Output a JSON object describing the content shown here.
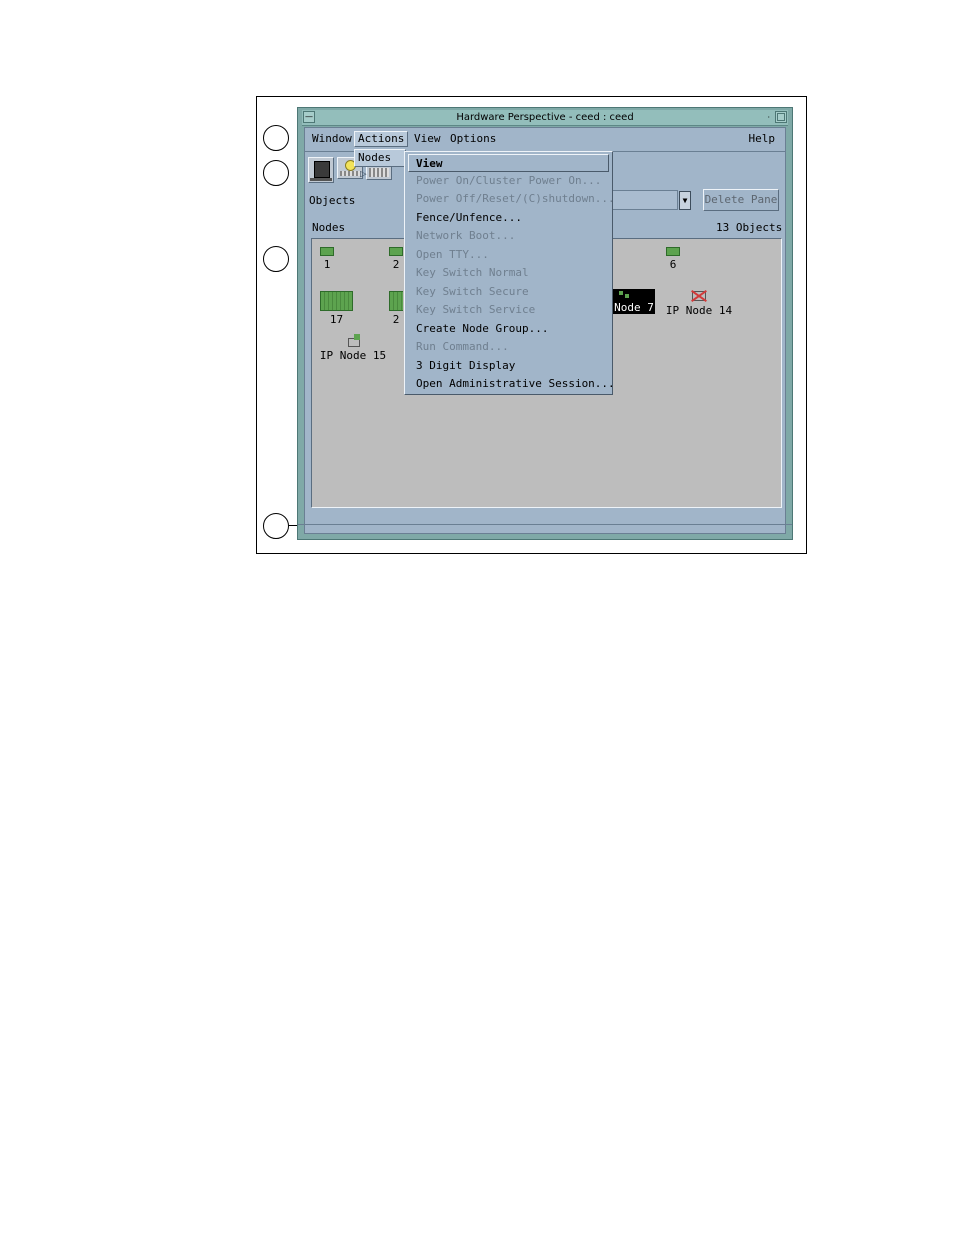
{
  "window": {
    "title": "Hardware Perspective - ceed : ceed"
  },
  "menubar": {
    "items": [
      "Window",
      "Actions",
      "View",
      "Options"
    ],
    "help": "Help"
  },
  "toolbar": {
    "buttons": [
      {
        "icon": "notebook-icon"
      },
      {
        "icon": "lightbulb-icon"
      },
      {
        "icon": "power-off-icon"
      }
    ]
  },
  "objects_label": "Objects",
  "delete_pane_label": "Delete Pane",
  "pane": {
    "title": "Nodes",
    "count": "13 Objects",
    "nodes": [
      "1",
      "2",
      "6",
      "17",
      "2",
      "Node 7",
      "IP Node 14",
      "IP Node 15"
    ]
  },
  "submenu": {
    "label": "Nodes",
    "arrow": "▷"
  },
  "dropdown": {
    "items": [
      {
        "label": "View",
        "enabled": true
      },
      {
        "label": "Power On/Cluster Power On...",
        "enabled": false
      },
      {
        "label": "Power Off/Reset/(C)shutdown...",
        "enabled": false
      },
      {
        "label": "Fence/Unfence...",
        "enabled": true
      },
      {
        "label": "Network Boot...",
        "enabled": false
      },
      {
        "label": "Open TTY...",
        "enabled": false
      },
      {
        "label": "Key Switch Normal",
        "enabled": false
      },
      {
        "label": "Key Switch Secure",
        "enabled": false
      },
      {
        "label": "Key Switch Service",
        "enabled": false
      },
      {
        "label": "Create Node Group...",
        "enabled": true
      },
      {
        "label": "Run Command...",
        "enabled": false
      },
      {
        "label": "3 Digit Display",
        "enabled": true
      },
      {
        "label": "Open Administrative Session...",
        "enabled": true
      }
    ]
  },
  "colors": {
    "window_frame": "#7fa9a7",
    "panel": "#a1b5c9",
    "pane_background": "#bdbdbd",
    "node_icon": "#5da34f"
  }
}
